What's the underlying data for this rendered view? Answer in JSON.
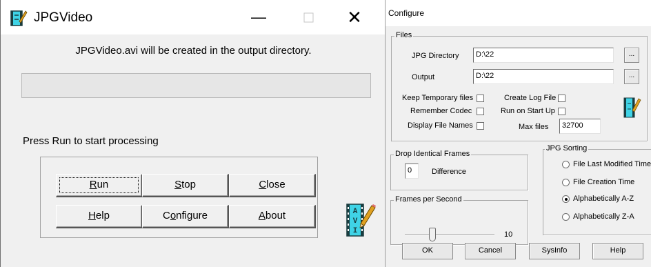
{
  "jpgvideo": {
    "title": "JPGVideo",
    "minimize_glyph": "—",
    "close_glyph": "✕",
    "message": "JPGVideo.avi will be created  in the output directory.",
    "prompt": "Press Run to start processing",
    "buttons": {
      "run": "Run",
      "run_rest": "un",
      "run_key": "R",
      "stop": "Stop",
      "stop_key": "S",
      "stop_rest": "top",
      "close": "Close",
      "close_key": "C",
      "close_rest": "lose",
      "help": "Help",
      "help_key": "H",
      "help_rest": "elp",
      "configure": "Configure",
      "configure_pre": "C",
      "configure_key": "o",
      "configure_rest": "nfigure",
      "about": "About",
      "about_key": "A",
      "about_rest": "bout"
    },
    "logo_letters": [
      "A",
      "V",
      "I"
    ]
  },
  "configure": {
    "title": "Configure",
    "files": {
      "legend": "Files",
      "jpg_directory_label": "JPG Directory",
      "jpg_directory_value": "D:\\22",
      "output_label": "Output",
      "output_value": "D:\\22",
      "browse_label": "...",
      "keep_temp_label": "Keep Temporary files",
      "remember_codec_label": "Remember Codec",
      "display_names_label": "Display File Names",
      "create_log_label": "Create Log File",
      "run_startup_label": "Run on Start Up",
      "max_files_label": "Max files",
      "max_files_value": "32700"
    },
    "drop": {
      "legend": "Drop Identical Frames",
      "value": "0",
      "label": "Difference"
    },
    "fps": {
      "legend": "Frames per Second",
      "value": "10"
    },
    "sorting": {
      "legend": "JPG Sorting",
      "options": [
        "File Last Modified Time",
        "File Creation Time",
        "Alphabetically A-Z",
        "Alphabetically Z-A"
      ],
      "selected": "Alphabetically A-Z"
    },
    "buttons": {
      "ok": "OK",
      "cancel": "Cancel",
      "sysinfo": "SysInfo",
      "help": "Help"
    }
  },
  "colors": {
    "logo_cyan": "#3fd3e6",
    "logo_dark": "#1a3c3f",
    "pencil": "#e0a020"
  }
}
